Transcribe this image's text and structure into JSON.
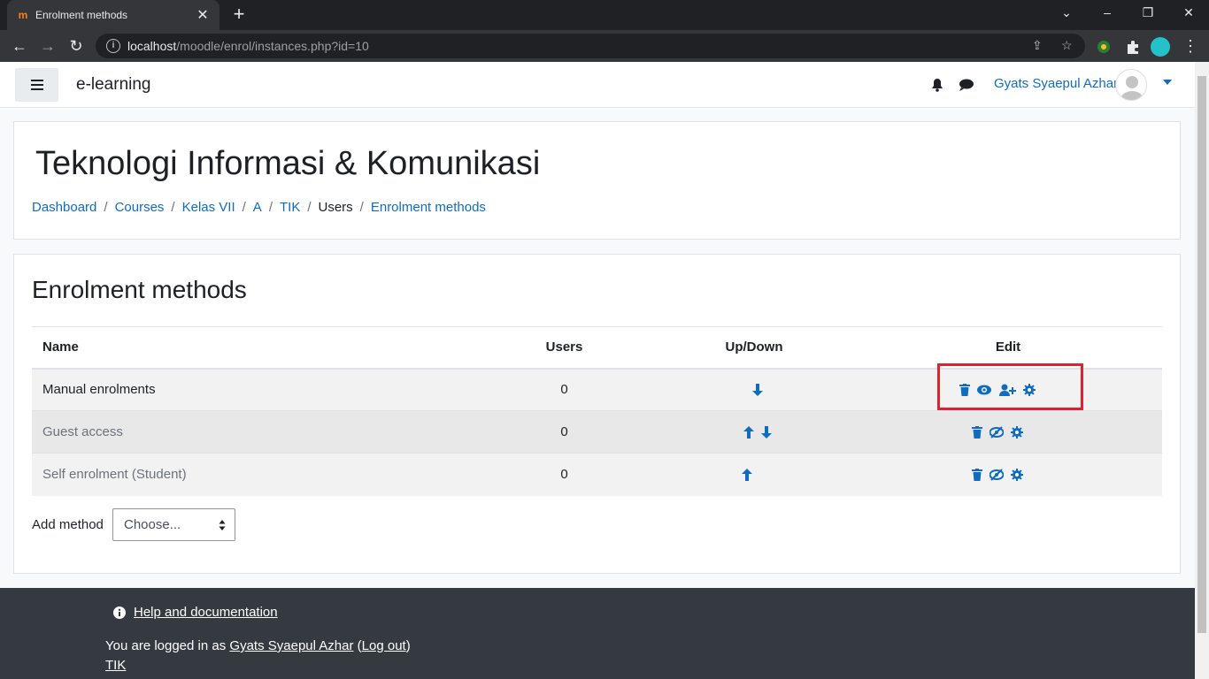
{
  "browser": {
    "tab_title": "Enrolment methods",
    "url_host": "localhost",
    "url_path": "/moodle/enrol/instances.php?id=10"
  },
  "navbar": {
    "brand": "e-learning",
    "user_name": "Gyats Syaepul Azhar"
  },
  "header": {
    "course_title": "Teknologi Informasi & Komunikasi",
    "breadcrumb": [
      "Dashboard",
      "Courses",
      "Kelas VII",
      "A",
      "TIK",
      "Users",
      "Enrolment methods"
    ]
  },
  "main": {
    "title": "Enrolment methods",
    "columns": [
      "Name",
      "Users",
      "Up/Down",
      "Edit"
    ],
    "rows": [
      {
        "name": "Manual enrolments",
        "users": "0"
      },
      {
        "name": "Guest access",
        "users": "0"
      },
      {
        "name": "Self enrolment (Student)",
        "users": "0"
      }
    ],
    "add_method_label": "Add method",
    "add_method_value": "Choose..."
  },
  "footer": {
    "help_label": "Help and documentation",
    "logged_in_prefix": "You are logged in as",
    "logged_in_user": "Gyats Syaepul Azhar",
    "logout_label": "Log out",
    "course_link": "TIK"
  },
  "colors": {
    "link": "#0f6cbf",
    "highlight": "#e5202e",
    "footer_bg": "#343a40"
  }
}
